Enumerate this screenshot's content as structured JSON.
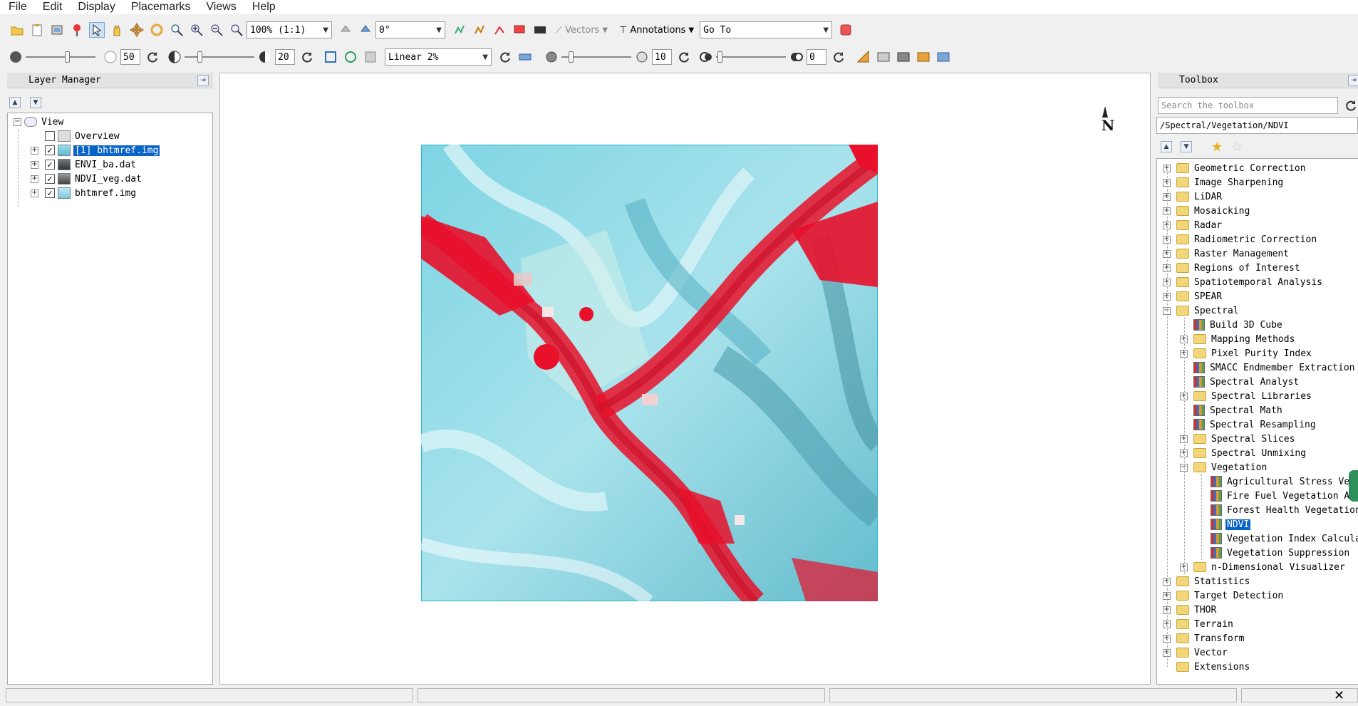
{
  "menu": [
    "File",
    "Edit",
    "Display",
    "Placemarks",
    "Views",
    "Help"
  ],
  "toolbar1": {
    "zoom_value": "100% (1:1)",
    "rotation_value": "0°",
    "vectors_label": "Vectors",
    "annotations_label": "Annotations",
    "goto_value": "Go To"
  },
  "toolbar2": {
    "brightness_value": "50",
    "contrast_value": "20",
    "stretch_value": "Linear 2%",
    "sharpen_value": "10",
    "transparency_value": "0"
  },
  "layer_manager": {
    "title": "Layer Manager",
    "root": "View",
    "items": [
      {
        "label": "Overview",
        "checked": false,
        "selected": false,
        "expandable": false
      },
      {
        "label": "[1] bhtmref.img",
        "checked": true,
        "selected": true,
        "expandable": true
      },
      {
        "label": "ENVI_ba.dat",
        "checked": true,
        "selected": false,
        "expandable": true
      },
      {
        "label": "NDVI_veg.dat",
        "checked": true,
        "selected": false,
        "expandable": true
      },
      {
        "label": "bhtmref.img",
        "checked": true,
        "selected": false,
        "expandable": true
      }
    ]
  },
  "view": {
    "north_arrow": "N"
  },
  "toolbox": {
    "title": "Toolbox",
    "search_placeholder": "Search the toolbox",
    "path": "/Spectral/Vegetation/NDVI",
    "items": [
      {
        "label": "Geometric Correction",
        "kind": "folder",
        "level": 0,
        "expander": "+"
      },
      {
        "label": "Image Sharpening",
        "kind": "folder",
        "level": 0,
        "expander": "+"
      },
      {
        "label": "LiDAR",
        "kind": "folder",
        "level": 0,
        "expander": "+"
      },
      {
        "label": "Mosaicking",
        "kind": "folder",
        "level": 0,
        "expander": "+"
      },
      {
        "label": "Radar",
        "kind": "folder",
        "level": 0,
        "expander": "+"
      },
      {
        "label": "Radiometric Correction",
        "kind": "folder",
        "level": 0,
        "expander": "+"
      },
      {
        "label": "Raster Management",
        "kind": "folder",
        "level": 0,
        "expander": "+"
      },
      {
        "label": "Regions of Interest",
        "kind": "folder",
        "level": 0,
        "expander": "+"
      },
      {
        "label": "Spatiotemporal Analysis",
        "kind": "folder",
        "level": 0,
        "expander": "+"
      },
      {
        "label": "SPEAR",
        "kind": "folder",
        "level": 0,
        "expander": "+"
      },
      {
        "label": "Spectral",
        "kind": "folder",
        "level": 0,
        "expander": "-"
      },
      {
        "label": "Build 3D Cube",
        "kind": "tool",
        "level": 1,
        "expander": ""
      },
      {
        "label": "Mapping Methods",
        "kind": "folder",
        "level": 1,
        "expander": "+"
      },
      {
        "label": "Pixel Purity Index",
        "kind": "folder",
        "level": 1,
        "expander": "+"
      },
      {
        "label": "SMACC Endmember Extraction",
        "kind": "tool",
        "level": 1,
        "expander": ""
      },
      {
        "label": "Spectral Analyst",
        "kind": "tool",
        "level": 1,
        "expander": ""
      },
      {
        "label": "Spectral Libraries",
        "kind": "folder",
        "level": 1,
        "expander": "+"
      },
      {
        "label": "Spectral Math",
        "kind": "tool",
        "level": 1,
        "expander": ""
      },
      {
        "label": "Spectral Resampling",
        "kind": "tool",
        "level": 1,
        "expander": ""
      },
      {
        "label": "Spectral Slices",
        "kind": "folder",
        "level": 1,
        "expander": "+"
      },
      {
        "label": "Spectral Unmixing",
        "kind": "folder",
        "level": 1,
        "expander": "+"
      },
      {
        "label": "Vegetation",
        "kind": "folder",
        "level": 1,
        "expander": "-"
      },
      {
        "label": "Agricultural Stress Ve",
        "kind": "tool",
        "level": 2,
        "expander": ""
      },
      {
        "label": "Fire Fuel Vegetation A",
        "kind": "tool",
        "level": 2,
        "expander": ""
      },
      {
        "label": "Forest Health Vegetation",
        "kind": "tool",
        "level": 2,
        "expander": ""
      },
      {
        "label": "NDVI",
        "kind": "tool",
        "level": 2,
        "expander": "",
        "selected": true
      },
      {
        "label": "Vegetation Index Calcula",
        "kind": "tool",
        "level": 2,
        "expander": ""
      },
      {
        "label": "Vegetation Suppression",
        "kind": "tool",
        "level": 2,
        "expander": ""
      },
      {
        "label": "n-Dimensional Visualizer",
        "kind": "folder",
        "level": 1,
        "expander": "+"
      },
      {
        "label": "Statistics",
        "kind": "folder",
        "level": 0,
        "expander": "+"
      },
      {
        "label": "Target Detection",
        "kind": "folder",
        "level": 0,
        "expander": "+"
      },
      {
        "label": "THOR",
        "kind": "folder",
        "level": 0,
        "expander": "+"
      },
      {
        "label": "Terrain",
        "kind": "folder",
        "level": 0,
        "expander": "+"
      },
      {
        "label": "Transform",
        "kind": "folder",
        "level": 0,
        "expander": "+"
      },
      {
        "label": "Vector",
        "kind": "folder",
        "level": 0,
        "expander": "+"
      },
      {
        "label": "Extensions",
        "kind": "folder",
        "level": 0,
        "expander": ""
      }
    ]
  },
  "colors": {
    "selection": "#0a64c8",
    "image_frame": "#29b6c9",
    "vegetation": "#e8102a",
    "terrain": "#8ed8e6"
  },
  "status_bar": {
    "close_label": "✕"
  }
}
